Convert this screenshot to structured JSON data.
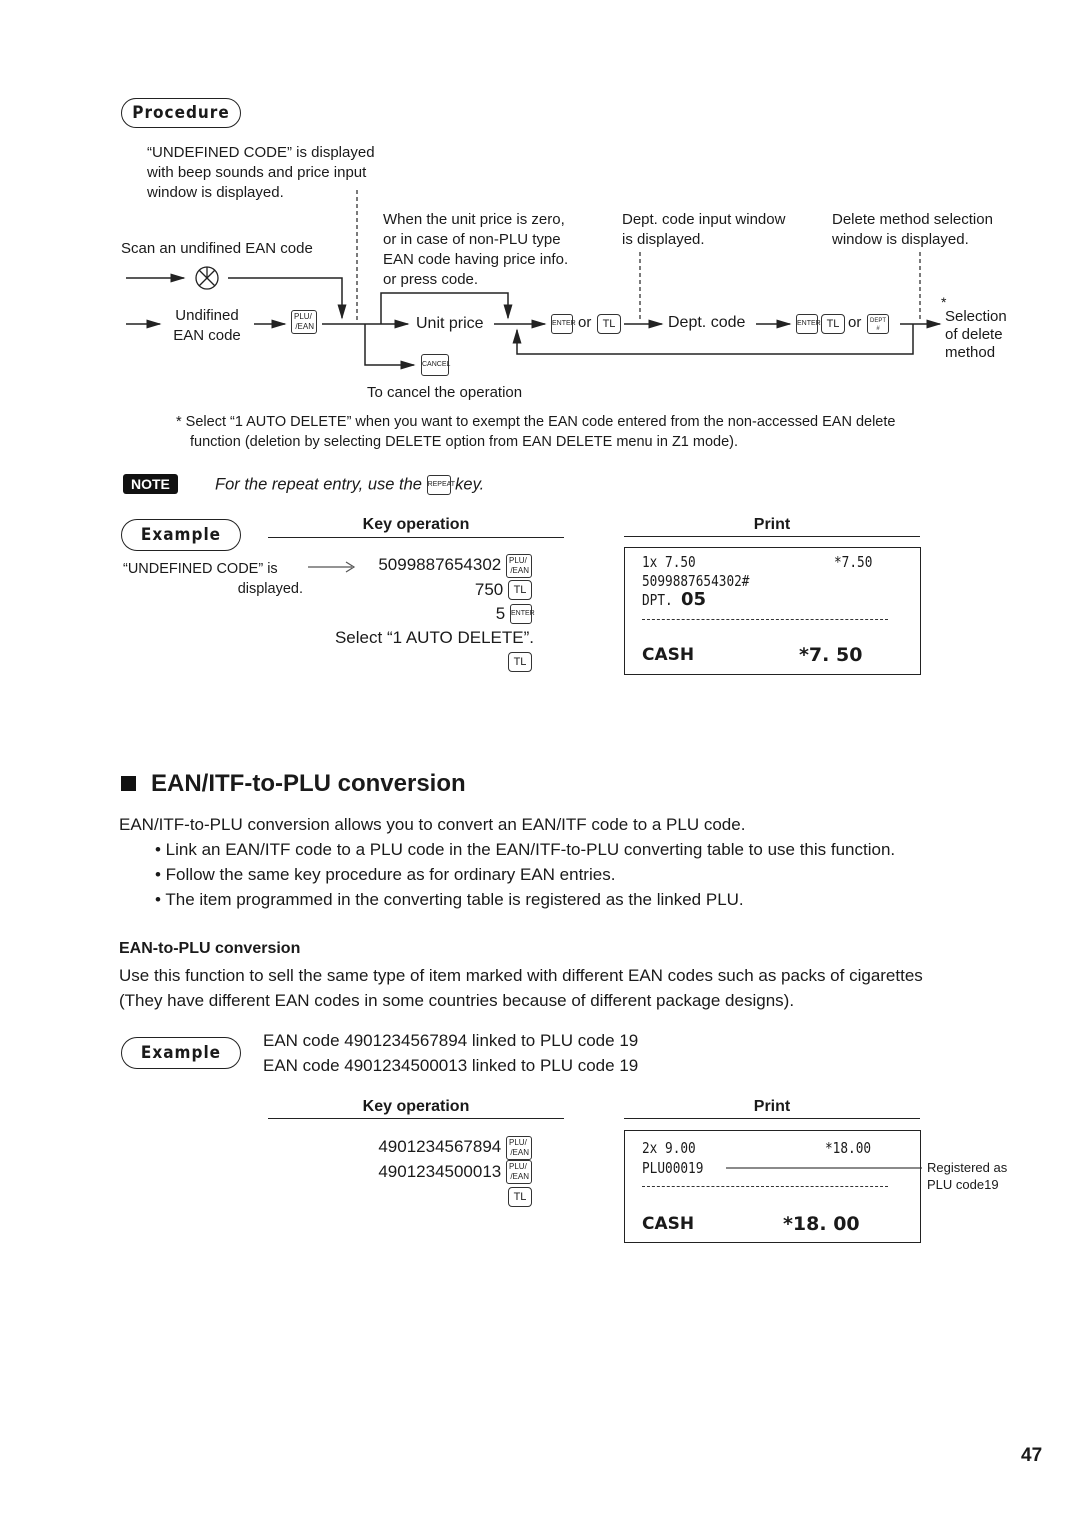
{
  "procedure": {
    "badge": "Procedure",
    "undefined_note": [
      "“UNDEFINED CODE” is displayed",
      "with beep sounds and price input",
      "window is displayed."
    ],
    "scan_label": "Scan an undifined EAN code",
    "undefined_ean": [
      "Undifined",
      "EAN code"
    ],
    "zero_price_note": [
      "When the unit price is zero,",
      "or in case of non-PLU type",
      "EAN code having price info.",
      "or press code."
    ],
    "dept_window_note": [
      "Dept. code input window",
      "is displayed."
    ],
    "delete_window_note": [
      "Delete method selection",
      "window is displayed."
    ],
    "unit_price": "Unit price",
    "or1": "or",
    "dept_code": "Dept. code",
    "or2": "or",
    "selection_asterisk": "*",
    "selection": [
      "Selection",
      "of delete",
      "method"
    ],
    "cancel_caption": "To cancel the operation",
    "footnote": [
      "* Select “1 AUTO DELETE” when you want to exempt the EAN code entered from the non-accessed EAN delete",
      "function (deletion by selecting DELETE option from EAN DELETE menu in Z1 mode)."
    ]
  },
  "keys": {
    "plu_top": "PLU/",
    "plu_bottom": "/EAN",
    "enter": "ENTER",
    "tl": "TL",
    "dept_top": "DEPT",
    "dept_bottom": "#",
    "cancel": "CANCEL",
    "repeat": "REPEAT"
  },
  "note": {
    "badge": "NOTE",
    "text_before": "For the repeat entry, use the",
    "text_after": "key."
  },
  "example1": {
    "badge": "Example",
    "key_operation_header": "Key operation",
    "print_header": "Print",
    "side_note": [
      "“UNDEFINED CODE” is",
      "displayed."
    ],
    "steps": [
      "5099887654302",
      "750",
      "5",
      "Select “1 AUTO DELETE”."
    ],
    "receipt": {
      "line1_left": "1x 7.50",
      "line1_right": "*7.50",
      "line2": "5099887654302#",
      "line3_prefix": "DPT.",
      "line3_value": "05",
      "total_label": "CASH",
      "total_value": "*7. 50"
    }
  },
  "section": {
    "title": "EAN/ITF-to-PLU conversion",
    "intro": "EAN/ITF-to-PLU conversion allows you to convert an EAN/ITF code to a PLU code.",
    "bullets": [
      "• Link an EAN/ITF code to a PLU code in the EAN/ITF-to-PLU converting table to use this function.",
      "• Follow the same key procedure as for ordinary EAN entries.",
      "• The item programmed in the converting table is registered as the linked PLU."
    ],
    "sub_title": "EAN-to-PLU conversion",
    "sub_text": [
      "Use this function to sell the same type of item marked with different EAN codes such as packs of cigarettes",
      "(They have different EAN codes in some countries because of different package designs)."
    ]
  },
  "example2": {
    "badge": "Example",
    "lines": [
      "EAN code 4901234567894 linked to PLU code 19",
      "EAN code 4901234500013 linked to PLU code 19"
    ],
    "key_operation_header": "Key operation",
    "print_header": "Print",
    "steps": [
      "4901234567894",
      "4901234500013"
    ],
    "receipt": {
      "line1_left": "2x 9.00",
      "line1_right": "*18.00",
      "line2": "PLU00019",
      "total_label": "CASH",
      "total_value": "*18. 00"
    },
    "annotation": [
      "Registered as",
      "PLU code19"
    ]
  },
  "page_number": "47"
}
